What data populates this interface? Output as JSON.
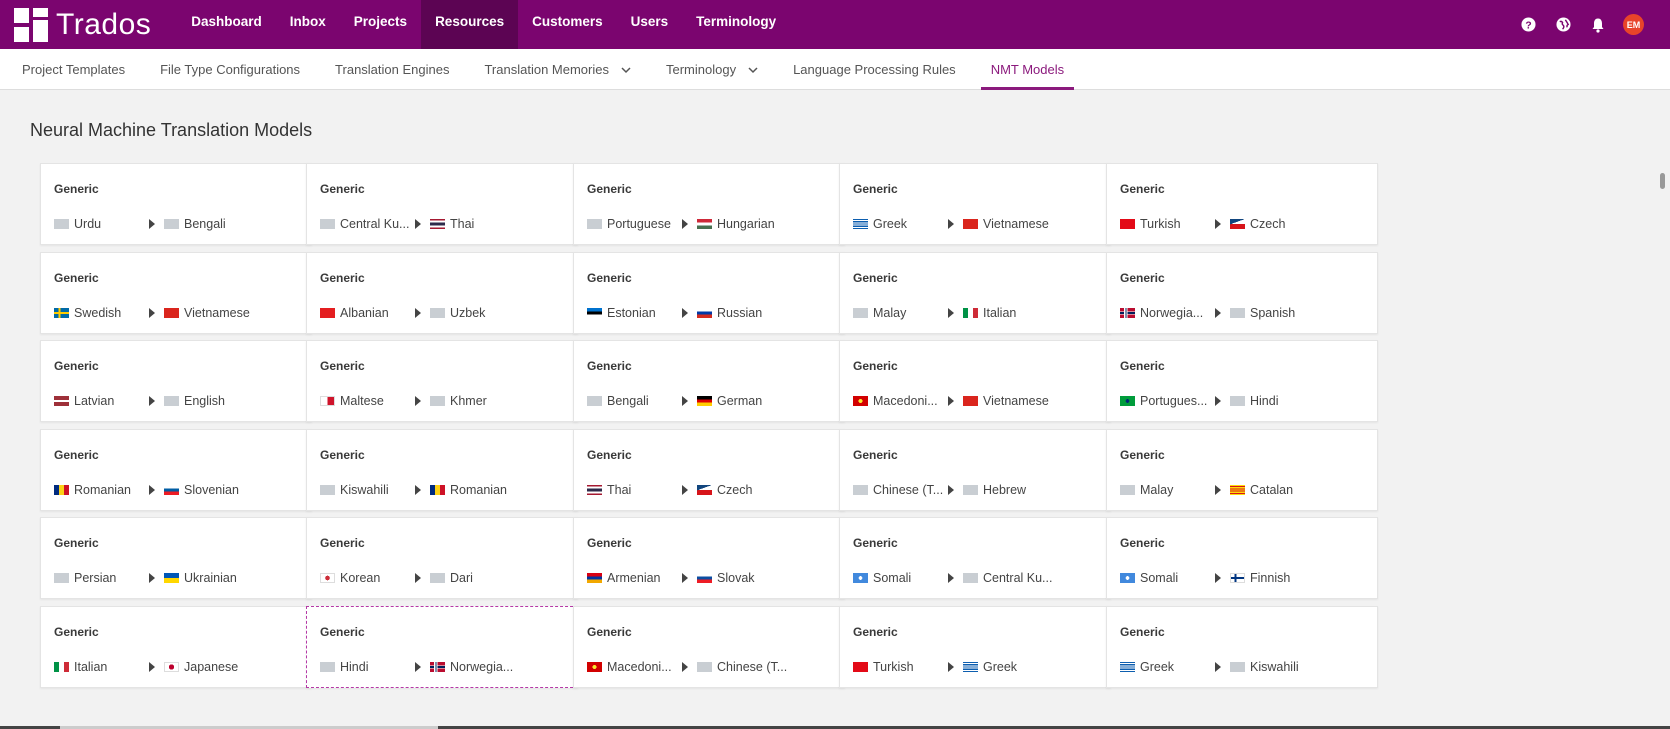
{
  "app": {
    "logo_text": "Trados",
    "brand_color": "#7b056f"
  },
  "mainnav": [
    "Dashboard",
    "Inbox",
    "Projects",
    "Resources",
    "Customers",
    "Users",
    "Terminology"
  ],
  "mainnav_active": "Resources",
  "topbar": {
    "icons": [
      "help-icon",
      "globe-icon",
      "bell-icon"
    ],
    "avatar_initials": "EM"
  },
  "subnav": [
    {
      "label": "Project Templates",
      "dropdown": false
    },
    {
      "label": "File Type Configurations",
      "dropdown": false
    },
    {
      "label": "Translation Engines",
      "dropdown": false
    },
    {
      "label": "Translation Memories",
      "dropdown": true
    },
    {
      "label": "Terminology",
      "dropdown": true
    },
    {
      "label": "Language Processing Rules",
      "dropdown": false
    },
    {
      "label": "NMT Models",
      "dropdown": false,
      "active": true
    }
  ],
  "page": {
    "title": "Neural Machine Translation Models"
  },
  "cards": [
    {
      "title": "Generic",
      "source": "Urdu",
      "source_flag": "gray",
      "target": "Bengali",
      "target_flag": "gray"
    },
    {
      "title": "Generic",
      "source": "Central Ku...",
      "source_flag": "gray",
      "target": "Thai",
      "target_flag": "th"
    },
    {
      "title": "Generic",
      "source": "Portuguese",
      "source_flag": "gray",
      "target": "Hungarian",
      "target_flag": "hu"
    },
    {
      "title": "Generic",
      "source": "Greek",
      "source_flag": "gr",
      "target": "Vietnamese",
      "target_flag": "vn"
    },
    {
      "title": "Generic",
      "source": "Turkish",
      "source_flag": "tr",
      "target": "Czech",
      "target_flag": "cz"
    },
    {
      "title": "Generic",
      "source": "Swedish",
      "source_flag": "se",
      "target": "Vietnamese",
      "target_flag": "vn"
    },
    {
      "title": "Generic",
      "source": "Albanian",
      "source_flag": "al",
      "target": "Uzbek",
      "target_flag": "gray"
    },
    {
      "title": "Generic",
      "source": "Estonian",
      "source_flag": "ee",
      "target": "Russian",
      "target_flag": "ru"
    },
    {
      "title": "Generic",
      "source": "Malay",
      "source_flag": "gray",
      "target": "Italian",
      "target_flag": "it"
    },
    {
      "title": "Generic",
      "source": "Norwegia...",
      "source_flag": "no",
      "target": "Spanish",
      "target_flag": "gray"
    },
    {
      "title": "Generic",
      "source": "Latvian",
      "source_flag": "lv",
      "target": "English",
      "target_flag": "gray"
    },
    {
      "title": "Generic",
      "source": "Maltese",
      "source_flag": "mt",
      "target": "Khmer",
      "target_flag": "gray"
    },
    {
      "title": "Generic",
      "source": "Bengali",
      "source_flag": "gray",
      "target": "German",
      "target_flag": "de"
    },
    {
      "title": "Generic",
      "source": "Macedoni...",
      "source_flag": "mk",
      "target": "Vietnamese",
      "target_flag": "vn"
    },
    {
      "title": "Generic",
      "source": "Portugues...",
      "source_flag": "br",
      "target": "Hindi",
      "target_flag": "gray"
    },
    {
      "title": "Generic",
      "source": "Romanian",
      "source_flag": "ro",
      "target": "Slovenian",
      "target_flag": "si"
    },
    {
      "title": "Generic",
      "source": "Kiswahili",
      "source_flag": "gray",
      "target": "Romanian",
      "target_flag": "ro"
    },
    {
      "title": "Generic",
      "source": "Thai",
      "source_flag": "th",
      "target": "Czech",
      "target_flag": "cz"
    },
    {
      "title": "Generic",
      "source": "Chinese (T...",
      "source_flag": "gray",
      "target": "Hebrew",
      "target_flag": "gray"
    },
    {
      "title": "Generic",
      "source": "Malay",
      "source_flag": "gray",
      "target": "Catalan",
      "target_flag": "ca"
    },
    {
      "title": "Generic",
      "source": "Persian",
      "source_flag": "gray",
      "target": "Ukrainian",
      "target_flag": "ua"
    },
    {
      "title": "Generic",
      "source": "Korean",
      "source_flag": "kr",
      "target": "Dari",
      "target_flag": "gray"
    },
    {
      "title": "Generic",
      "source": "Armenian",
      "source_flag": "am",
      "target": "Slovak",
      "target_flag": "sk"
    },
    {
      "title": "Generic",
      "source": "Somali",
      "source_flag": "so",
      "target": "Central Ku...",
      "target_flag": "gray"
    },
    {
      "title": "Generic",
      "source": "Somali",
      "source_flag": "so",
      "target": "Finnish",
      "target_flag": "fi"
    },
    {
      "title": "Generic",
      "source": "Italian",
      "source_flag": "it",
      "target": "Japanese",
      "target_flag": "jp"
    },
    {
      "title": "Generic",
      "source": "Hindi",
      "source_flag": "gray",
      "target": "Norwegia...",
      "target_flag": "no",
      "selected": true
    },
    {
      "title": "Generic",
      "source": "Macedoni...",
      "source_flag": "mk",
      "target": "Chinese (T...",
      "target_flag": "gray"
    },
    {
      "title": "Generic",
      "source": "Turkish",
      "source_flag": "tr",
      "target": "Greek",
      "target_flag": "gr"
    },
    {
      "title": "Generic",
      "source": "Greek",
      "source_flag": "gr",
      "target": "Kiswahili",
      "target_flag": "gray"
    }
  ]
}
